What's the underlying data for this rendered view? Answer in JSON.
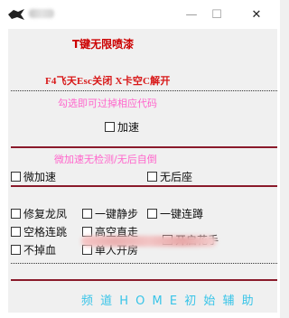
{
  "titlebar": {
    "minimize_label": "—",
    "maximize_label": "☐",
    "close_label": "✕"
  },
  "header": {
    "title": "T键无限喷漆",
    "hotkeys": "F4飞天Esc关闭   X卡空C解开"
  },
  "section_hint_1": "勾选即可过掉相应代码",
  "accelerate": {
    "label": "加速"
  },
  "section_hint_2": "微加速无检测/无后自倒",
  "row_a": [
    {
      "label": "微加速"
    },
    {
      "label": "无后座"
    }
  ],
  "grid": [
    {
      "label": "修复龙凤"
    },
    {
      "label": "一键静步"
    },
    {
      "label": "一键连蹲"
    },
    {
      "label": "空格连跳"
    },
    {
      "label": "高空直走"
    },
    {
      "label": "开启花手"
    },
    {
      "label": "不掉血"
    },
    {
      "label": "单人开房"
    }
  ],
  "footer": "频 道 H O M E 初 始 辅 助",
  "colors": {
    "accent_red": "#cc0000",
    "hint_pink": "#ff66cc",
    "footer_cyan": "#38c4e8",
    "divider_red": "#8a1a2a"
  }
}
